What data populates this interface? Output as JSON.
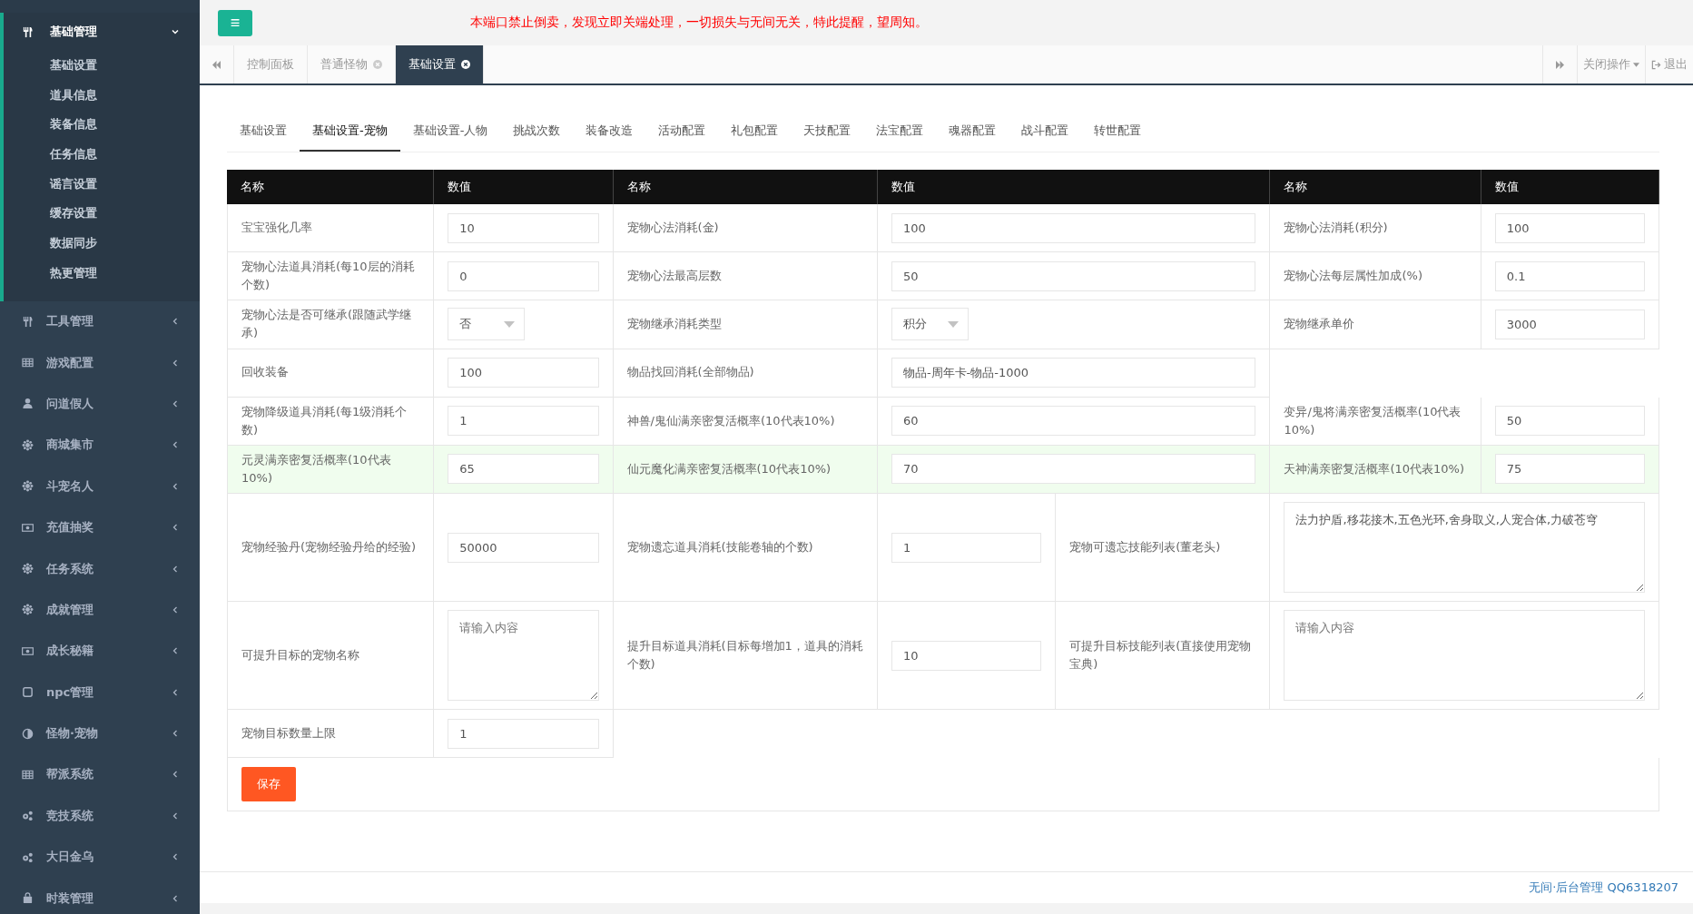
{
  "sidebar": {
    "items": [
      {
        "label": "基础管理",
        "expanded": true,
        "children": [
          {
            "label": "基础设置"
          },
          {
            "label": "道具信息"
          },
          {
            "label": "装备信息"
          },
          {
            "label": "任务信息"
          },
          {
            "label": "谣言设置"
          },
          {
            "label": "缓存设置"
          },
          {
            "label": "数据同步"
          },
          {
            "label": "热更管理"
          }
        ]
      },
      {
        "label": "工具管理",
        "expanded": false
      },
      {
        "label": "游戏配置",
        "expanded": false
      },
      {
        "label": "问道假人",
        "expanded": false
      },
      {
        "label": "商城集市",
        "expanded": false
      },
      {
        "label": "斗宠名人",
        "expanded": false
      },
      {
        "label": "充值抽奖",
        "expanded": false
      },
      {
        "label": "任务系统",
        "expanded": false
      },
      {
        "label": "成就管理",
        "expanded": false
      },
      {
        "label": "成长秘籍",
        "expanded": false
      },
      {
        "label": "npc管理",
        "expanded": false
      },
      {
        "label": "怪物·宠物",
        "expanded": false
      },
      {
        "label": "帮派系统",
        "expanded": false
      },
      {
        "label": "竞技系统",
        "expanded": false
      },
      {
        "label": "大日金乌",
        "expanded": false
      },
      {
        "label": "时装管理",
        "expanded": false
      }
    ]
  },
  "header": {
    "menu_icon": "≡",
    "notice": "本端口禁止倒卖，发现立即关端处理，一切损失与无间无关，特此提醒，望周知。"
  },
  "page_tabs": [
    {
      "label": "控制面板",
      "selected": false,
      "closable": false
    },
    {
      "label": "普通怪物",
      "selected": false,
      "closable": true
    },
    {
      "label": "基础设置",
      "selected": true,
      "closable": true
    }
  ],
  "tab_actions": {
    "close_menu": "关闭操作",
    "logout": "退出"
  },
  "sub_tabs": [
    {
      "label": "基础设置",
      "selected": false
    },
    {
      "label": "基础设置-宠物",
      "selected": true
    },
    {
      "label": "基础设置-人物",
      "selected": false
    },
    {
      "label": "挑战次数",
      "selected": false
    },
    {
      "label": "装备改造",
      "selected": false
    },
    {
      "label": "活动配置",
      "selected": false
    },
    {
      "label": "礼包配置",
      "selected": false
    },
    {
      "label": "天技配置",
      "selected": false
    },
    {
      "label": "法宝配置",
      "selected": false
    },
    {
      "label": "魂器配置",
      "selected": false
    },
    {
      "label": "战斗配置",
      "selected": false
    },
    {
      "label": "转世配置",
      "selected": false
    }
  ],
  "table": {
    "columns": [
      "名称",
      "数值",
      "名称",
      "数值",
      "名称",
      "数值"
    ],
    "rows": [
      {
        "kind": "regular",
        "highlighted": false,
        "cells": [
          {
            "kind": "label",
            "text": "宝宝强化几率"
          },
          {
            "kind": "input",
            "value": "10"
          },
          {
            "kind": "label",
            "text": "宠物心法消耗(金)"
          },
          {
            "kind": "input",
            "value": "100"
          },
          {
            "kind": "label",
            "text": "宠物心法消耗(积分)"
          },
          {
            "kind": "input",
            "value": "100"
          }
        ]
      },
      {
        "kind": "regular",
        "highlighted": false,
        "cells": [
          {
            "kind": "label",
            "text": "宠物心法道具消耗(每10层的消耗个数)"
          },
          {
            "kind": "input",
            "value": "0"
          },
          {
            "kind": "label",
            "text": "宠物心法最高层数"
          },
          {
            "kind": "input",
            "value": "50"
          },
          {
            "kind": "label",
            "text": "宠物心法每层属性加成(%)"
          },
          {
            "kind": "input",
            "value": "0.1"
          }
        ]
      },
      {
        "kind": "regular",
        "highlighted": false,
        "cells": [
          {
            "kind": "label",
            "text": "宠物心法是否可继承(跟随武学继承)"
          },
          {
            "kind": "select",
            "value": "否"
          },
          {
            "kind": "label",
            "text": "宠物继承消耗类型"
          },
          {
            "kind": "select",
            "value": "积分"
          },
          {
            "kind": "label",
            "text": "宠物继承单价"
          },
          {
            "kind": "input",
            "value": "3000"
          }
        ]
      },
      {
        "kind": "regular",
        "highlighted": false,
        "cells": [
          {
            "kind": "label",
            "text": "回收装备"
          },
          {
            "kind": "input",
            "value": "100"
          },
          {
            "kind": "label",
            "text": "物品找回消耗(全部物品)"
          },
          {
            "kind": "input",
            "value": "物品-周年卡-物品-1000"
          }
        ]
      },
      {
        "kind": "regular",
        "highlighted": false,
        "cells": [
          {
            "kind": "label",
            "text": "宠物降级道具消耗(每1级消耗个数)"
          },
          {
            "kind": "input",
            "value": "1"
          },
          {
            "kind": "label",
            "text": "神兽/鬼仙满亲密复活概率(10代表10%)"
          },
          {
            "kind": "input",
            "value": "60"
          },
          {
            "kind": "label",
            "text": "变异/鬼将满亲密复活概率(10代表10%)"
          },
          {
            "kind": "input",
            "value": "50"
          }
        ]
      },
      {
        "kind": "regular",
        "highlighted": true,
        "cells": [
          {
            "kind": "label",
            "text": "元灵满亲密复活概率(10代表10%)"
          },
          {
            "kind": "input",
            "value": "65"
          },
          {
            "kind": "label",
            "text": "仙元魔化满亲密复活概率(10代表10%)"
          },
          {
            "kind": "input",
            "value": "70"
          },
          {
            "kind": "label",
            "text": "天神满亲密复活概率(10代表10%)"
          },
          {
            "kind": "input",
            "value": "75"
          }
        ]
      },
      {
        "kind": "split",
        "highlighted": false,
        "cells": [
          {
            "kind": "label",
            "text": "宠物经验丹(宠物经验丹给的经验)"
          },
          {
            "kind": "input",
            "value": "50000"
          },
          {
            "kind": "label",
            "text": "宠物遗忘道具消耗(技能卷轴的个数)"
          },
          {
            "kind": "input",
            "value": "1"
          },
          {
            "kind": "label",
            "text": "宠物可遗忘技能列表(董老头)"
          },
          {
            "kind": "textarea",
            "value": "法力护盾,移花接木,五色光环,舍身取义,人宠合体,力破苍穹"
          }
        ]
      },
      {
        "kind": "split",
        "highlighted": false,
        "cells": [
          {
            "kind": "label",
            "text": "可提升目标的宠物名称"
          },
          {
            "kind": "textarea",
            "placeholder": "请输入内容"
          },
          {
            "kind": "label",
            "text": "提升目标道具消耗(目标每增加1，道具的消耗个数)"
          },
          {
            "kind": "input",
            "value": "10"
          },
          {
            "kind": "label",
            "text": "可提升目标技能列表(直接使用宠物宝典)"
          },
          {
            "kind": "textarea",
            "placeholder": "请输入内容"
          }
        ]
      },
      {
        "kind": "regular",
        "highlighted": false,
        "cells": [
          {
            "kind": "label",
            "text": "宠物目标数量上限"
          },
          {
            "kind": "input",
            "value": "1"
          }
        ]
      }
    ]
  },
  "save_button": "保存",
  "footer": "无间·后台管理 QQ6318207"
}
